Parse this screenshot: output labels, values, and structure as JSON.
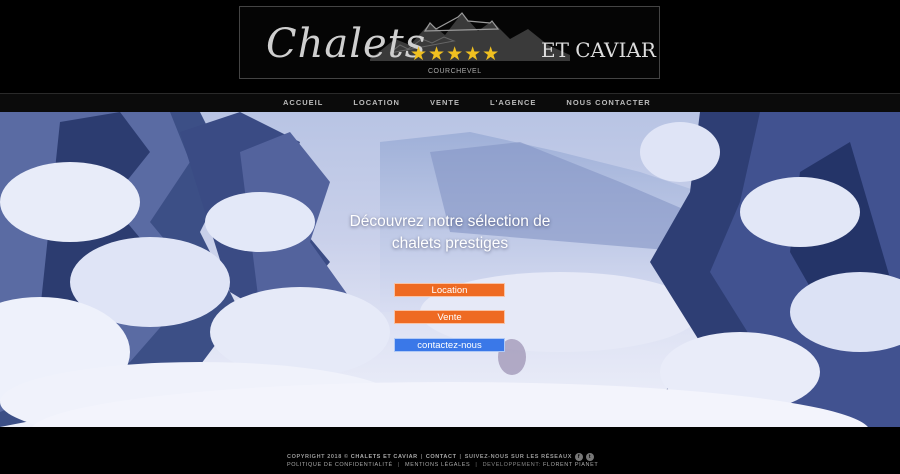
{
  "header": {
    "logo": {
      "script_text": "Chalets",
      "stars": "★★★★★",
      "subtitle": "COURCHEVEL",
      "caviar_text": "ET CAVIAR"
    }
  },
  "nav": {
    "items": [
      "ACCUEIL",
      "LOCATION",
      "VENTE",
      "L'AGENCE",
      "NOUS CONTACTER"
    ]
  },
  "hero": {
    "headline_line1": "Découvrez notre sélection de",
    "headline_line2": "chalets prestiges",
    "buttons": {
      "location": "Location",
      "vente": "Vente",
      "contact": "contactez-nous"
    },
    "colors": {
      "orange": "#ee6a22",
      "blue": "#3a78e8"
    }
  },
  "footer": {
    "copyright": "COPYRIGHT 2018 ©",
    "brand_link": "CHALETS ET CAVIAR",
    "contact_link": "CONTACT",
    "social_text": "SUIVEZ-NOUS SUR LES RÉSEAUX",
    "social_facebook": "f",
    "social_twitter": "t",
    "privacy_link": "POLITIQUE DE CONFIDENTIALITÉ",
    "legal_link": "MENTIONS LÉGALES",
    "dev_text": "DEVELOPPEMENT:",
    "dev_link": "FLORENT PIANET"
  }
}
